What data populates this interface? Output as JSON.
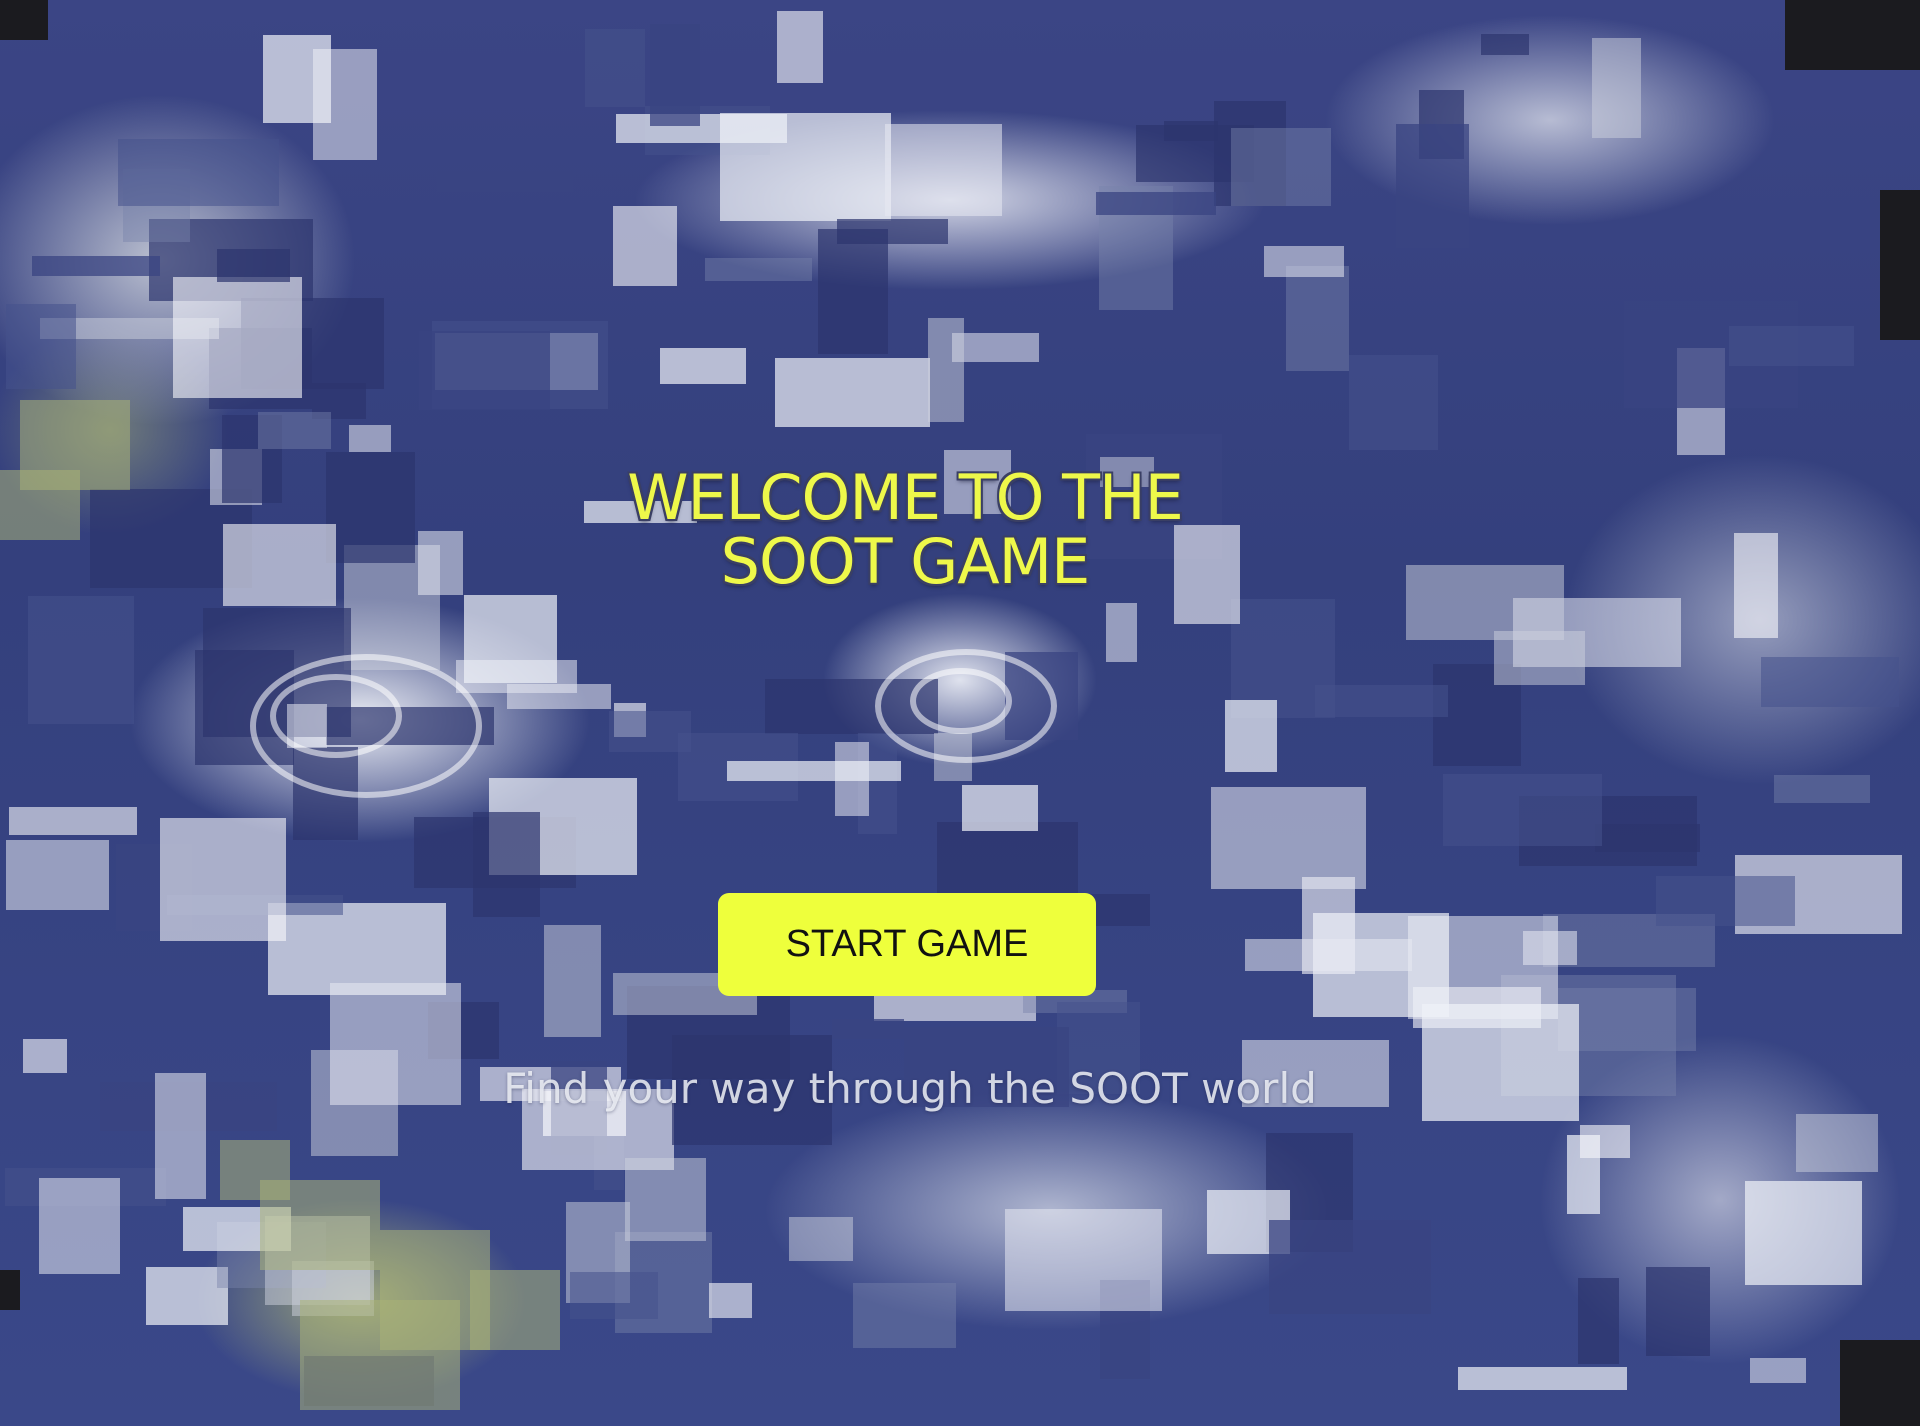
{
  "game": {
    "title": "WELCOME TO THE SOOT GAME",
    "start_button_label": "START GAME",
    "subtitle": "Find your way through the SOOT world"
  },
  "theme": {
    "accent": "#EEFF3C",
    "title_color": "#EEF84A",
    "ocean": "#38437F",
    "cloud": "#E8EAF2",
    "land": "#AEB77A"
  },
  "background": {
    "description_icon": "satellite-earth-glitch-background"
  }
}
